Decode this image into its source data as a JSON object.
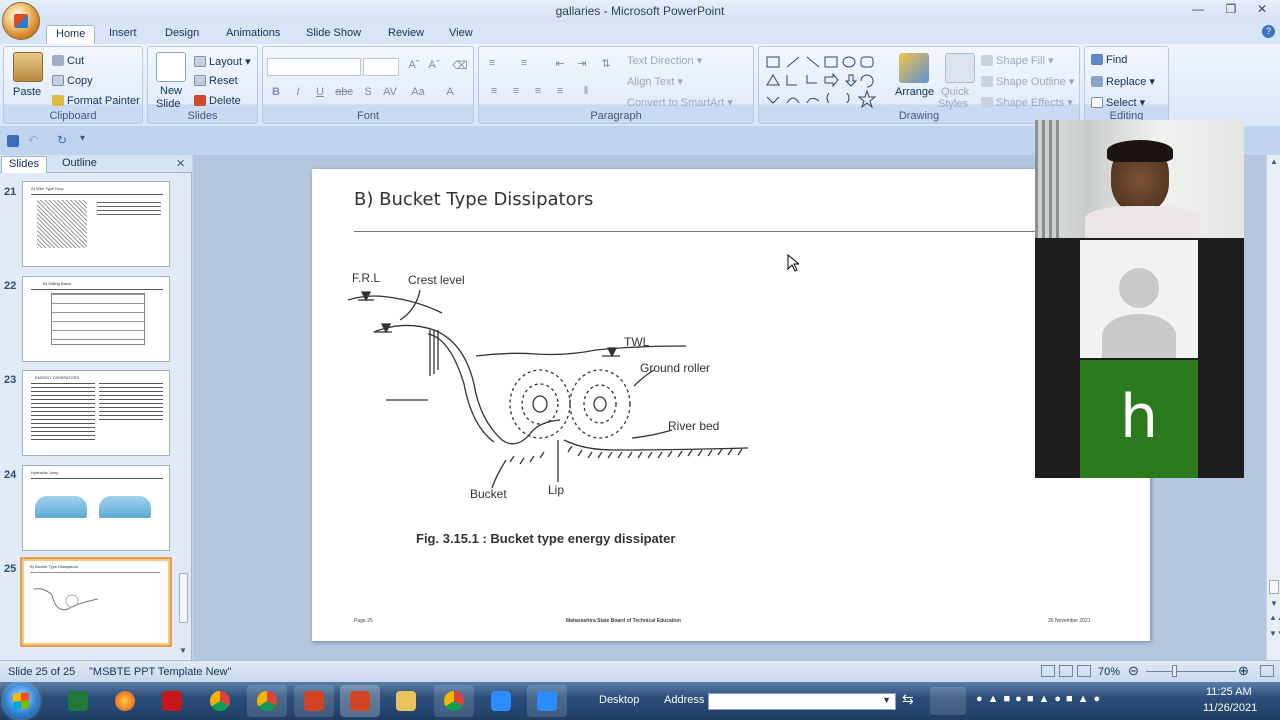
{
  "window": {
    "title": "gallaries - Microsoft PowerPoint"
  },
  "tabs": [
    "Home",
    "Insert",
    "Design",
    "Animations",
    "Slide Show",
    "Review",
    "View"
  ],
  "ribbon": {
    "clipboard": {
      "paste": "Paste",
      "cut": "Cut",
      "copy": "Copy",
      "format_painter": "Format Painter",
      "label": "Clipboard"
    },
    "slides": {
      "new_slide_1": "New",
      "new_slide_2": "Slide",
      "layout": "Layout",
      "reset": "Reset",
      "delete": "Delete",
      "label": "Slides"
    },
    "font": {
      "label": "Font"
    },
    "paragraph": {
      "text_direction": "Text Direction",
      "align_text": "Align Text",
      "convert_smartart": "Convert to SmartArt",
      "label": "Paragraph"
    },
    "drawing": {
      "arrange": "Arrange",
      "quick_styles_1": "Quick",
      "quick_styles_2": "Styles",
      "shape_fill": "Shape Fill",
      "shape_outline": "Shape Outline",
      "shape_effects": "Shape Effects",
      "label": "Drawing"
    },
    "editing": {
      "find": "Find",
      "replace": "Replace",
      "select": "Select",
      "label": "Editing"
    }
  },
  "left_panel": {
    "tabs": [
      "Slides",
      "Outline"
    ],
    "thumbnails": [
      {
        "num": "21",
        "title": "A) Weir Type Drop"
      },
      {
        "num": "22",
        "title": "B) Stilling Basin"
      },
      {
        "num": "23",
        "title": "ENERGY DISSIPATORS"
      },
      {
        "num": "24",
        "title": "Hydraulic Jump"
      },
      {
        "num": "25",
        "title": "B) Bucket Type Dissipators"
      }
    ]
  },
  "slide": {
    "title": "B) Bucket Type Dissipators",
    "diagram_labels": {
      "frl": "F.R.L",
      "crest": "Crest level",
      "twl": "TWL",
      "ground_roller": "Ground roller",
      "river_bed": "River bed",
      "bucket": "Bucket",
      "lip": "Lip"
    },
    "caption": "Fig. 3.15.1 : Bucket type energy dissipater",
    "footer_left": "Page 25",
    "footer_center": "Maharashtra State Board of Technical Education",
    "footer_right": "26 November 2021"
  },
  "webcam": {
    "tile3_letter": "h"
  },
  "status": {
    "slide_count": "Slide 25 of 25",
    "theme": "\"MSBTE PPT Template New\"",
    "zoom": "70%"
  },
  "taskbar": {
    "desktop": "Desktop",
    "address": "Address",
    "time": "11:25 AM",
    "date": "11/26/2021"
  },
  "colors": {
    "ribbon_bg": "#dbe8f7",
    "slide_bg": "#ffffff",
    "taskbar": "#1f3e66",
    "cam_green": "#2b7a1d"
  }
}
